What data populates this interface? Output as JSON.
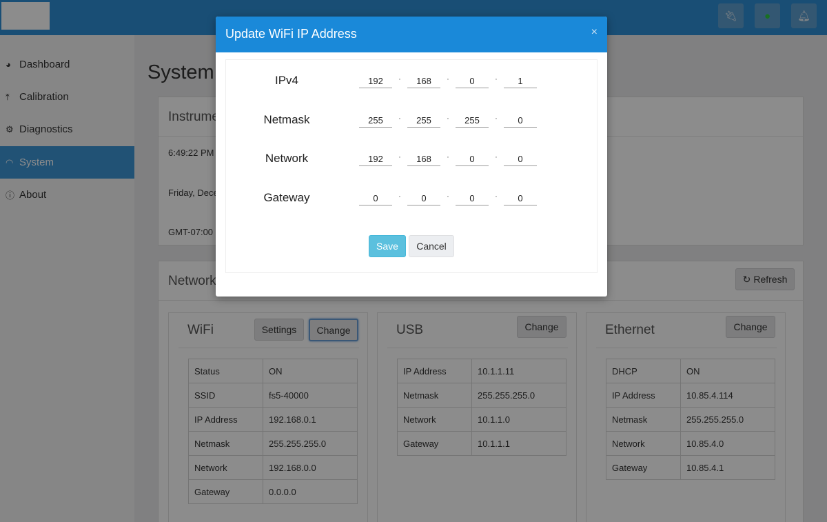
{
  "topbar": {
    "icons": [
      "plug-icon",
      "map-pin-icon",
      "bell-icon"
    ]
  },
  "sidebar": {
    "items": [
      {
        "label": "Dashboard",
        "icon": "dashboard-icon"
      },
      {
        "label": "Calibration",
        "icon": "upload-icon"
      },
      {
        "label": "Diagnostics",
        "icon": "gears-icon"
      },
      {
        "label": "System",
        "icon": "wifi-icon",
        "active": true
      },
      {
        "label": "About",
        "icon": "info-icon"
      }
    ]
  },
  "main": {
    "page_title": "System",
    "instrument": {
      "title": "Instrume",
      "time": "6:49:22 PM",
      "date": "Friday, Dece",
      "timezone": "GMT-07:00"
    },
    "network": {
      "title": "Network",
      "refresh_label": "Refresh",
      "wifi": {
        "title": "WiFi",
        "settings_label": "Settings",
        "change_label": "Change",
        "rows": [
          {
            "key": "Status",
            "value": "ON"
          },
          {
            "key": "SSID",
            "value": "fs5-40000"
          },
          {
            "key": "IP Address",
            "value": "192.168.0.1"
          },
          {
            "key": "Netmask",
            "value": "255.255.255.0"
          },
          {
            "key": "Network",
            "value": "192.168.0.0"
          },
          {
            "key": "Gateway",
            "value": "0.0.0.0"
          }
        ]
      },
      "usb": {
        "title": "USB",
        "change_label": "Change",
        "rows": [
          {
            "key": "IP Address",
            "value": "10.1.1.11"
          },
          {
            "key": "Netmask",
            "value": "255.255.255.0"
          },
          {
            "key": "Network",
            "value": "10.1.1.0"
          },
          {
            "key": "Gateway",
            "value": "10.1.1.1"
          }
        ]
      },
      "ethernet": {
        "title": "Ethernet",
        "change_label": "Change",
        "rows": [
          {
            "key": "DHCP",
            "value": "ON"
          },
          {
            "key": "IP Address",
            "value": "10.85.4.114"
          },
          {
            "key": "Netmask",
            "value": "255.255.255.0"
          },
          {
            "key": "Network",
            "value": "10.85.4.0"
          },
          {
            "key": "Gateway",
            "value": "10.85.4.1"
          }
        ]
      }
    }
  },
  "modal": {
    "title": "Update WiFi IP Address",
    "close": "×",
    "fields": [
      {
        "label": "IPv4",
        "octets": [
          "192",
          "168",
          "0",
          "1"
        ]
      },
      {
        "label": "Netmask",
        "octets": [
          "255",
          "255",
          "255",
          "0"
        ]
      },
      {
        "label": "Network",
        "octets": [
          "192",
          "168",
          "0",
          "0"
        ]
      },
      {
        "label": "Gateway",
        "octets": [
          "0",
          "0",
          "0",
          "0"
        ]
      }
    ],
    "save_label": "Save",
    "cancel_label": "Cancel"
  }
}
